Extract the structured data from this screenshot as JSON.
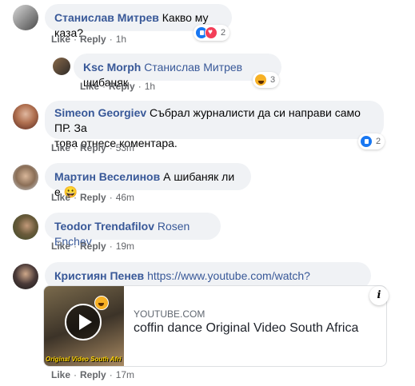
{
  "actions": {
    "like": "Like",
    "reply": "Reply"
  },
  "comments": [
    {
      "author": "Станислав Митрев",
      "text": "Какво му каза?",
      "time": "1h",
      "reaction_count": "2",
      "reactions": [
        "like-icon",
        "love-icon"
      ]
    },
    {
      "author": "Ksc Morph",
      "mention": "Станислав Митрев",
      "text": " шибаняк",
      "time": "1h",
      "reaction_count": "3",
      "reactions": [
        "haha-icon"
      ]
    },
    {
      "author": "Simeon Georgiev",
      "text": "Събрал журналисти да си направи само ПР. За това отнесе коментара.",
      "text_line1": "Събрал журналисти да си направи само ПР. За",
      "text_line2": "това отнесе коментара.",
      "time": "53m",
      "reaction_count": "2",
      "reactions": [
        "like-icon"
      ]
    },
    {
      "author": "Мартин Веселинов",
      "text": "А шибаняк ли е 😀",
      "time": "46m"
    },
    {
      "author": "Teodor Trendafilov",
      "mention": "Rosen Enchev",
      "time": "19m"
    },
    {
      "author": "Кристиян Пенев",
      "link": "https://www.youtube.com/watch?v=wuvaYSiYJjQ",
      "time": "17m",
      "preview": {
        "domain": "YOUTUBE.COM",
        "title": "coffin dance Original Video South Africa",
        "thumb_caption": "Original Video South Afri",
        "info_glyph": "i"
      }
    }
  ],
  "colors": {
    "name": "#385898",
    "bubble": "#f0f2f5",
    "meta": "#65676b",
    "like": "#1877f2",
    "love": "#f33e58",
    "haha": "#f7b125"
  }
}
